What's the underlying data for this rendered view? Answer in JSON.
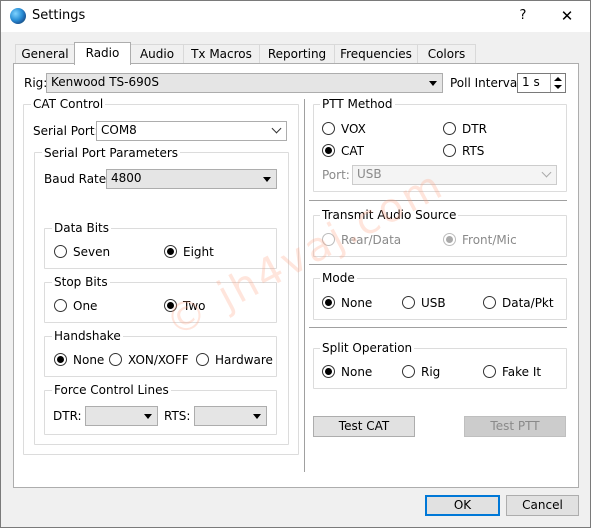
{
  "window": {
    "title": "Settings",
    "help": "?",
    "close": "✕"
  },
  "tabs": [
    "General",
    "Radio",
    "Audio",
    "Tx Macros",
    "Reporting",
    "Frequencies",
    "Colors"
  ],
  "rig": {
    "label": "Rig:",
    "value": "Kenwood TS-690S"
  },
  "poll": {
    "label": "Poll Interval:",
    "value": "1 s"
  },
  "cat": {
    "title": "CAT Control",
    "serial_port_label": "Serial Port:",
    "serial_port_value": "COM8",
    "params_title": "Serial Port Parameters",
    "baud_label": "Baud Rate:",
    "baud_value": "4800",
    "data_bits": {
      "title": "Data Bits",
      "options": [
        "Seven",
        "Eight"
      ],
      "selected": "Eight"
    },
    "stop_bits": {
      "title": "Stop Bits",
      "options": [
        "One",
        "Two"
      ],
      "selected": "Two"
    },
    "handshake": {
      "title": "Handshake",
      "options": [
        "None",
        "XON/XOFF",
        "Hardware"
      ],
      "selected": "None"
    },
    "force": {
      "title": "Force Control Lines",
      "dtr_label": "DTR:",
      "rts_label": "RTS:",
      "dtr_value": "",
      "rts_value": ""
    }
  },
  "ptt": {
    "title": "PTT Method",
    "options": [
      "VOX",
      "DTR",
      "CAT",
      "RTS"
    ],
    "selected": "CAT",
    "port_label": "Port:",
    "port_value": "USB"
  },
  "tx_audio": {
    "title": "Transmit Audio Source",
    "options": [
      "Rear/Data",
      "Front/Mic"
    ],
    "selected": "Front/Mic"
  },
  "mode": {
    "title": "Mode",
    "options": [
      "None",
      "USB",
      "Data/Pkt"
    ],
    "selected": "None"
  },
  "split": {
    "title": "Split Operation",
    "options": [
      "None",
      "Rig",
      "Fake It"
    ],
    "selected": "None"
  },
  "buttons": {
    "test_cat": "Test CAT",
    "test_ptt": "Test PTT",
    "ok": "OK",
    "cancel": "Cancel"
  },
  "watermark": "© jh4vaj.com",
  "colors": {
    "accent": "#0078d7",
    "panel": "#ffffff",
    "window": "#f0f0f0"
  }
}
